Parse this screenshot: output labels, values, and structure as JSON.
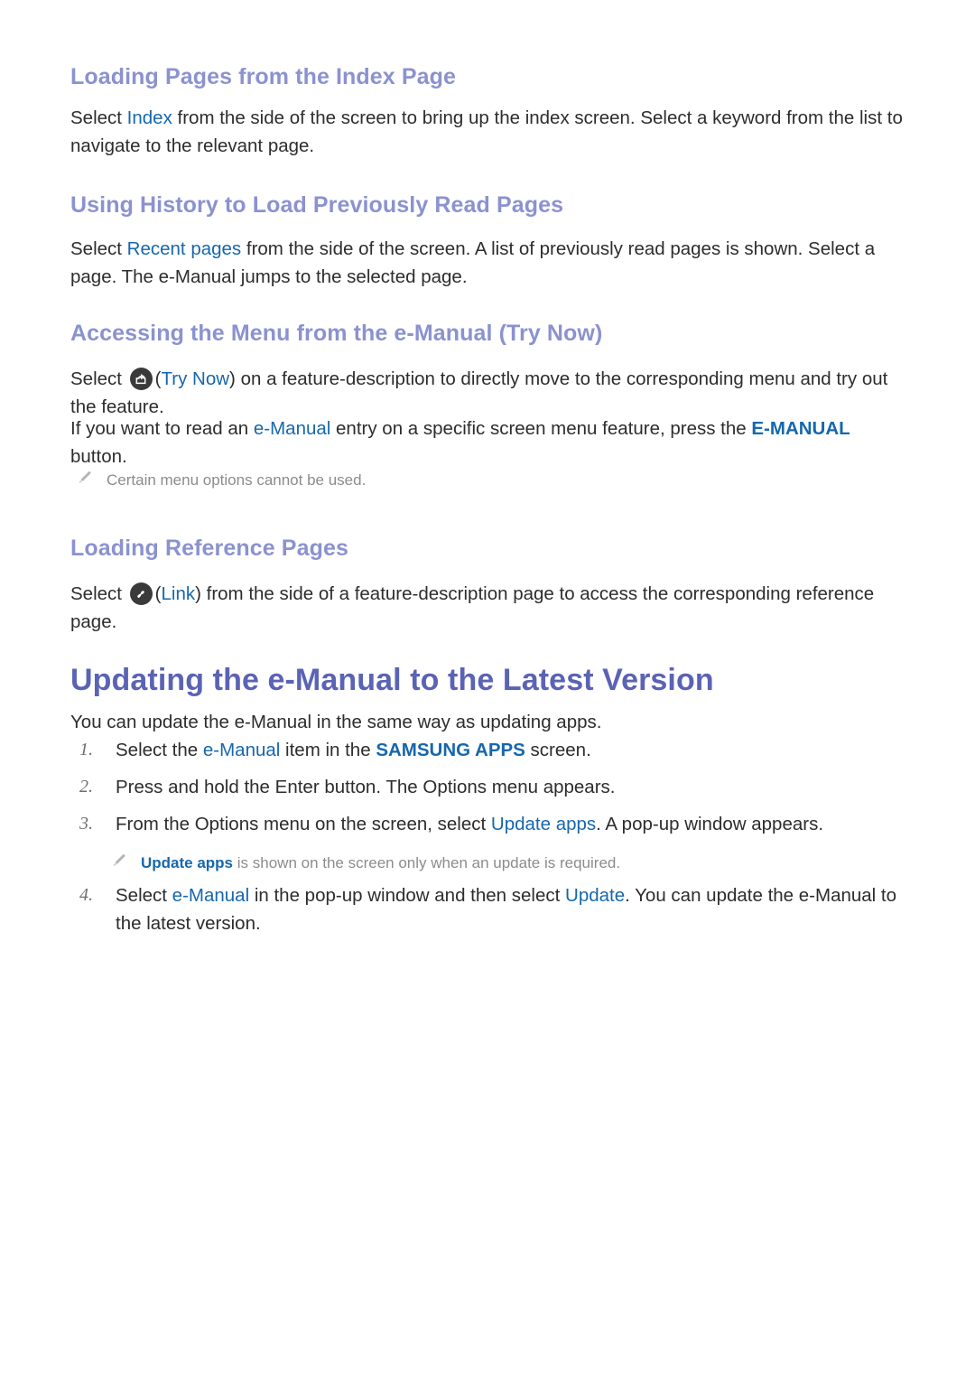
{
  "document": {
    "sections": [
      {
        "id": "loading-pages-index",
        "heading": "Loading Pages from the Index Page",
        "paragraph_parts": [
          {
            "t": "Select ",
            "style": "plain"
          },
          {
            "t": "Index",
            "style": "blue"
          },
          {
            "t": " from the side of the screen to bring up the index screen. Select a keyword from the list to navigate to the relevant page.",
            "style": "plain"
          }
        ]
      },
      {
        "id": "using-history",
        "heading": "Using History to Load Previously Read Pages",
        "paragraph_parts": [
          {
            "t": "Select ",
            "style": "plain"
          },
          {
            "t": "Recent pages",
            "style": "blue"
          },
          {
            "t": " from the side of the screen. A list of previously read pages is shown. Select a page. The e-Manual jumps to the selected page.",
            "style": "plain"
          }
        ]
      },
      {
        "id": "accessing-menu",
        "heading": "Accessing the Menu from the e-Manual (Try Now)",
        "paragraph_parts": [
          {
            "t": "Select ",
            "style": "plain"
          },
          {
            "t": "(",
            "style": "plain"
          },
          {
            "t": "Try Now",
            "style": "blue"
          },
          {
            "t": ") on a feature-description to directly move to the corresponding menu and try out the feature.",
            "style": "plain"
          }
        ]
      }
    ]
  },
  "s1": {
    "heading": "Loading Pages from the Index Page",
    "p_before": "Select ",
    "p_link": "Index",
    "p_after": " from the side of the screen to bring up the index screen. Select a keyword from the list to navigate to the relevant page."
  },
  "s2": {
    "heading": "Using History to Load Previously Read Pages",
    "p_before": "Select ",
    "p_link": "Recent pages",
    "p_after": " from the side of the screen. A list of previously read pages is shown. Select a page. The e-Manual jumps to the selected page."
  },
  "s3": {
    "heading": "Accessing the Menu from the e-Manual (Try Now)",
    "p1_before": "Select ",
    "p1_paren_open": "(",
    "p1_link": "Try Now",
    "p1_after": ") on a feature-description to directly move to the corresponding menu and try out the feature.",
    "p2_a": "If you want to read an ",
    "p2_link1": "e-Manual",
    "p2_b": " entry on a specific screen menu feature, press the ",
    "p2_link2": "E-MANUAL",
    "p2_c": " button.",
    "note": "Certain menu options cannot be used.",
    "icon_try_now": "share-export-icon",
    "icon_note": "pencil-icon"
  },
  "s4": {
    "heading": "Loading Reference Pages",
    "p_before": "Select ",
    "p_paren_open": "(",
    "p_link": "Link",
    "p_after": ") from the side of a feature-description page to access the corresponding reference page.",
    "icon_link": "chain-link-icon"
  },
  "main": {
    "heading": "Updating the e-Manual to the Latest Version",
    "intro": "You can update the e-Manual in the same way as updating apps.",
    "steps": [
      {
        "num": "1.",
        "a": "Select the ",
        "link1": "e-Manual",
        "b": " item in the ",
        "link2": "SAMSUNG APPS",
        "c": " screen."
      },
      {
        "num": "2.",
        "a": "Press and hold the Enter button. The Options menu appears.",
        "link1": "",
        "b": "",
        "link2": "",
        "c": ""
      },
      {
        "num": "3.",
        "a": "From the Options menu on the screen, select ",
        "link1": "Update apps",
        "b": ". A pop-up window appears.",
        "link2": "",
        "c": ""
      },
      {
        "num": "4.",
        "a": "Select ",
        "link1": "e-Manual",
        "b": " in the pop-up window and then select ",
        "link2": "Update",
        "c": ". You can update the e-Manual to the latest version."
      }
    ],
    "note": {
      "link": "Update apps",
      "text": " is shown on the screen only when an update is required.",
      "icon": "pencil-icon"
    }
  },
  "colors": {
    "sub_heading": "#8b92cf",
    "main_heading": "#5a63b4",
    "link_blue": "#1667ad",
    "body_text": "#2d2d2d",
    "note_gray": "#8c8c8c",
    "icon_circle": "#3a3a3a",
    "page_background": "#ffffff"
  }
}
